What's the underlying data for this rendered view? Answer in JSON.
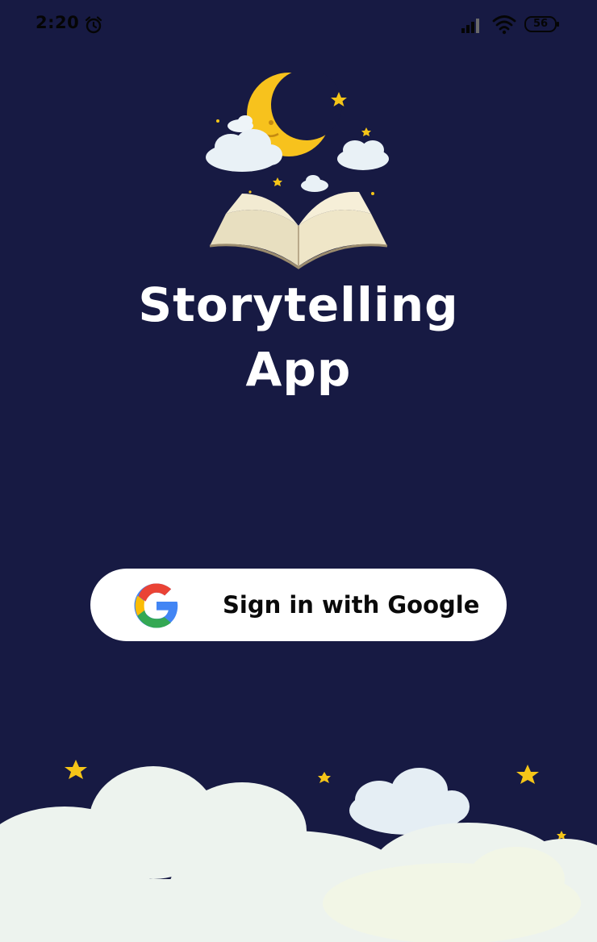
{
  "status_bar": {
    "time": "2:20",
    "battery": "56",
    "icons": [
      "alarm-clock-icon",
      "signal-icon",
      "wifi-icon",
      "battery-icon"
    ]
  },
  "app": {
    "title_line1": "Storytelling",
    "title_line2": "App",
    "logo": "moon-book-logo"
  },
  "sign_in": {
    "label": "Sign in with Google",
    "icon": "google-icon"
  },
  "colors": {
    "background": "#171a43",
    "button": "#ffffff",
    "star": "#f5c518",
    "moon": "#f7c21d",
    "cloud": "#eef4f8"
  }
}
